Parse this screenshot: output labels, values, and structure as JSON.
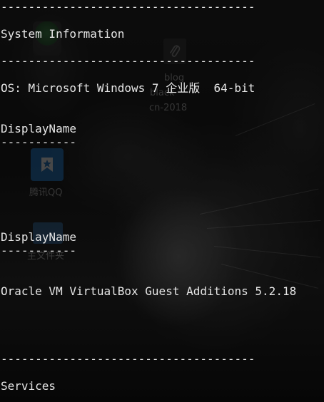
{
  "desktop": {
    "icons": [
      {
        "name": "recycle-bin",
        "label": "",
        "icon": "recycle-bin-icon"
      },
      {
        "name": "blog-shortcut",
        "label": "blog",
        "icon": "paperclip-icon"
      },
      {
        "name": "qq-shortcut",
        "label": "腾讯QQ",
        "icon": "qq-icon"
      },
      {
        "name": "folder-shortcut",
        "label": "主文件夹",
        "icon": "folder-icon"
      }
    ],
    "partial_labels": [
      "black",
      "cn-2018"
    ],
    "colors": {
      "qq": "#1d6fb8",
      "folder": "#2c5e8c",
      "recycle": "#2f7a3a"
    }
  },
  "console": {
    "lines": {
      "sep_top": "-------------------------------------",
      "system_info": "System Information",
      "sep_sys": "-------------------------------------",
      "os": "OS: Microsoft Windows 7 企业版  64-bit",
      "display_name_1": "DisplayName",
      "dash_1": "-----------",
      "display_name_2": "DisplayName",
      "dash_2": "-----------",
      "vbox": "Oracle VM VirtualBox Guest Additions 5.2.18",
      "sep_services": "-------------------------------------",
      "services": "Services"
    },
    "text_color": "#e6e6e6"
  }
}
